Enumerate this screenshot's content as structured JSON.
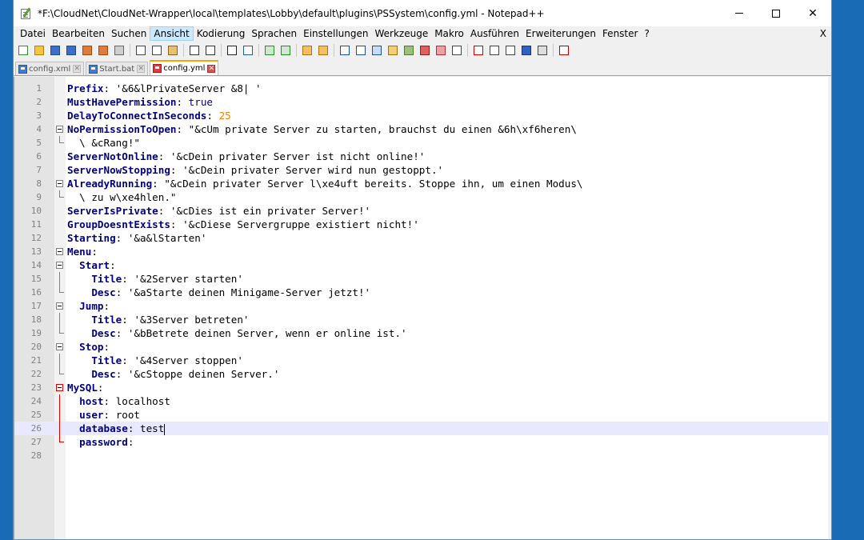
{
  "window": {
    "title": "*F:\\CloudNet\\CloudNet-Wrapper\\local\\templates\\Lobby\\default\\plugins\\PSSystem\\config.yml - Notepad++",
    "minimize_symbol": "—",
    "maximize_symbol": "☐",
    "close_symbol": "✕"
  },
  "menu": {
    "items": [
      "Datei",
      "Bearbeiten",
      "Suchen",
      "Ansicht",
      "Kodierung",
      "Sprachen",
      "Einstellungen",
      "Werkzeuge",
      "Makro",
      "Ausführen",
      "Erweiterungen",
      "Fenster",
      "?"
    ],
    "active_index": 3,
    "close_label": "X"
  },
  "tabs": [
    {
      "label": "config.xml",
      "active": false
    },
    {
      "label": "Start.bat",
      "active": false
    },
    {
      "label": "config.yml",
      "active": true
    }
  ],
  "tab_close_symbol": "✕",
  "editor": {
    "current_line": 26,
    "lines": [
      {
        "n": "1",
        "indent": "",
        "key": "Prefix",
        "sep": ": ",
        "val": "'&6&lPrivateServer &8| '"
      },
      {
        "n": "2",
        "indent": "",
        "key": "MustHavePermission",
        "sep": ": ",
        "val": "true",
        "valType": "bool"
      },
      {
        "n": "3",
        "indent": "",
        "key": "DelayToConnectInSeconds",
        "sep": ": ",
        "val": "25",
        "valType": "num"
      },
      {
        "n": "4",
        "indent": "",
        "key": "NoPermissionToOpen",
        "sep": ": ",
        "val": "\"&cUm private Server zu starten, brauchst du einen &6h\\xf6heren\\"
      },
      {
        "n": "5",
        "indent": "  ",
        "key": "",
        "sep": "",
        "val": "\\ &cRang!\""
      },
      {
        "n": "6",
        "indent": "",
        "key": "ServerNotOnline",
        "sep": ": ",
        "val": "'&cDein privater Server ist nicht online!'"
      },
      {
        "n": "7",
        "indent": "",
        "key": "ServerNowStopping",
        "sep": ": ",
        "val": "'&cDein privater Server wird nun gestoppt.'"
      },
      {
        "n": "8",
        "indent": "",
        "key": "AlreadyRunning",
        "sep": ": ",
        "val": "\"&cDein privater Server l\\xe4uft bereits. Stoppe ihn, um einen Modus\\"
      },
      {
        "n": "9",
        "indent": "  ",
        "key": "",
        "sep": "",
        "val": "\\ zu w\\xe4hlen.\""
      },
      {
        "n": "10",
        "indent": "",
        "key": "ServerIsPrivate",
        "sep": ": ",
        "val": "'&cDies ist ein privater Server!'"
      },
      {
        "n": "11",
        "indent": "",
        "key": "GroupDoesntExists",
        "sep": ": ",
        "val": "'&cDiese Servergruppe existiert nicht!'"
      },
      {
        "n": "12",
        "indent": "",
        "key": "Starting",
        "sep": ": ",
        "val": "'&a&lStarten'"
      },
      {
        "n": "13",
        "indent": "",
        "key": "Menu",
        "sep": ":",
        "val": ""
      },
      {
        "n": "14",
        "indent": "  ",
        "key": "Start",
        "sep": ":",
        "val": ""
      },
      {
        "n": "15",
        "indent": "    ",
        "key": "Title",
        "sep": ": ",
        "val": "'&2Server starten'"
      },
      {
        "n": "16",
        "indent": "    ",
        "key": "Desc",
        "sep": ": ",
        "val": "'&aStarte deinen Minigame-Server jetzt!'"
      },
      {
        "n": "17",
        "indent": "  ",
        "key": "Jump",
        "sep": ":",
        "val": ""
      },
      {
        "n": "18",
        "indent": "    ",
        "key": "Title",
        "sep": ": ",
        "val": "'&3Server betreten'"
      },
      {
        "n": "19",
        "indent": "    ",
        "key": "Desc",
        "sep": ": ",
        "val": "'&bBetrete deinen Server, wenn er online ist.'"
      },
      {
        "n": "20",
        "indent": "  ",
        "key": "Stop",
        "sep": ":",
        "val": ""
      },
      {
        "n": "21",
        "indent": "    ",
        "key": "Title",
        "sep": ": ",
        "val": "'&4Server stoppen'"
      },
      {
        "n": "22",
        "indent": "    ",
        "key": "Desc",
        "sep": ": ",
        "val": "'&cStoppe deinen Server.'"
      },
      {
        "n": "23",
        "indent": "",
        "key": "MySQL",
        "sep": ":",
        "val": ""
      },
      {
        "n": "24",
        "indent": "  ",
        "key": "host",
        "sep": ": ",
        "val": "localhost"
      },
      {
        "n": "25",
        "indent": "  ",
        "key": "user",
        "sep": ": ",
        "val": "root"
      },
      {
        "n": "26",
        "indent": "  ",
        "key": "database",
        "sep": ": ",
        "val": "test",
        "caret": true
      },
      {
        "n": "27",
        "indent": "  ",
        "key": "password",
        "sep": ":",
        "val": ""
      },
      {
        "n": "28",
        "indent": "",
        "key": "",
        "sep": "",
        "val": ""
      }
    ]
  }
}
